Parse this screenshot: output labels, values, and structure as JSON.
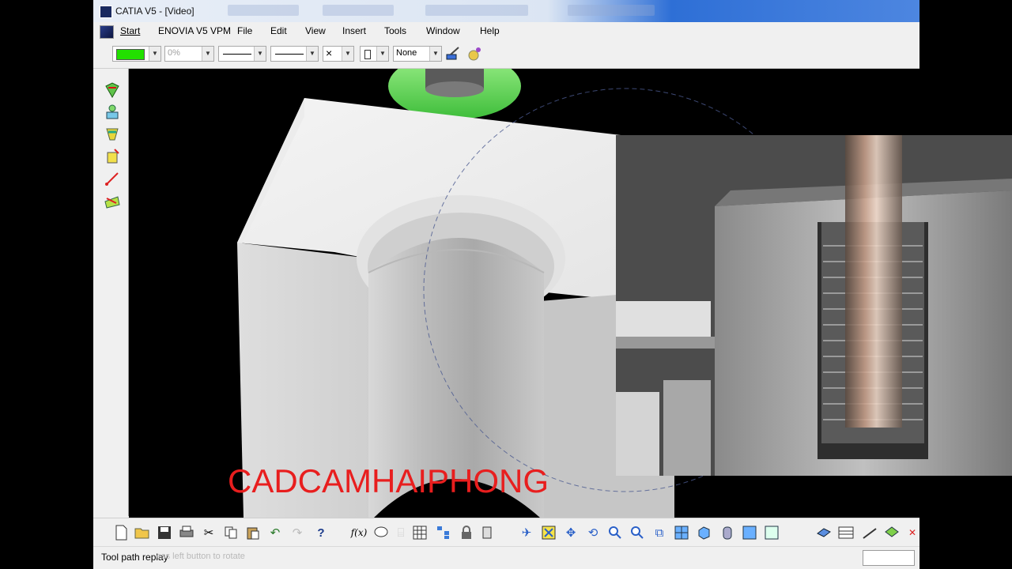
{
  "window": {
    "title": "CATIA V5 - [Video]"
  },
  "menu": {
    "items": [
      {
        "label": "Start",
        "active": true
      },
      {
        "label": "ENOVIA V5 VPM"
      },
      {
        "label": "File"
      },
      {
        "label": "Edit"
      },
      {
        "label": "View"
      },
      {
        "label": "Insert"
      },
      {
        "label": "Tools"
      },
      {
        "label": "Window"
      },
      {
        "label": "Help"
      }
    ]
  },
  "properties_toolbar": {
    "color_swatch": "#22e000",
    "transparency_value": "0%",
    "layer_value": "None",
    "close_glyph": "×"
  },
  "left_toolbar": {
    "icons": [
      "tool-path-icon",
      "operator-icon",
      "machining-icon",
      "part-operation-icon",
      "tool-path-edit-icon",
      "rework-area-icon"
    ]
  },
  "bottom_toolbar": {
    "icons": [
      "new-icon",
      "open-icon",
      "save-icon",
      "print-icon",
      "cut-icon",
      "copy-icon",
      "paste-icon",
      "undo-icon",
      "redo-icon",
      "whats-this-icon",
      "formula-icon",
      "knowledge-icon",
      "catalog-icon",
      "table-icon",
      "tree-icon",
      "lock-icon",
      "select-icon",
      "fly-icon",
      "fit-all-icon",
      "pan-icon",
      "rotate-icon",
      "zoom-in-icon",
      "zoom-out-icon",
      "normal-view-icon",
      "multi-view-icon",
      "iso-view-icon",
      "shading-icon",
      "hide-show-icon",
      "swap-icon",
      "plane-icon",
      "table2-icon",
      "measure-icon",
      "analysis-icon",
      "close-tools-icon"
    ],
    "formula_glyph": "f(x)"
  },
  "status": {
    "text": "Tool path replay",
    "hint": "ess left button to rotate"
  },
  "watermark": {
    "text": "CADCAMHAIPHONG"
  }
}
